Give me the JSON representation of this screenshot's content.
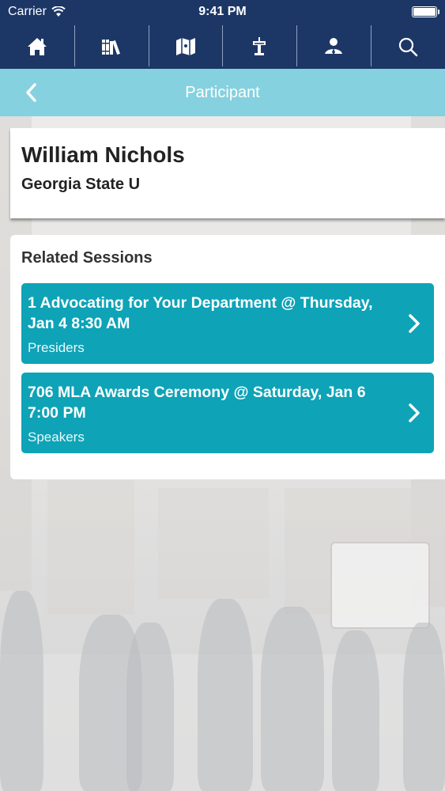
{
  "status_bar": {
    "carrier": "Carrier",
    "time": "9:41 PM",
    "wifi_icon": "wifi-icon",
    "battery_icon": "battery-icon"
  },
  "nav": {
    "items": [
      {
        "icon": "home-icon"
      },
      {
        "icon": "books-icon"
      },
      {
        "icon": "map-icon"
      },
      {
        "icon": "podium-icon"
      },
      {
        "icon": "person-icon"
      },
      {
        "icon": "search-icon"
      }
    ]
  },
  "header": {
    "title": "Participant",
    "back_icon": "chevron-left-icon",
    "color": "#86d1df"
  },
  "participant": {
    "name": "William Nichols",
    "organization": "Georgia State U"
  },
  "related_sessions": {
    "heading": "Related Sessions",
    "items": [
      {
        "title": "1 Advocating for Your Department @ Thursday, Jan 4 8:30 AM",
        "role": "Presiders"
      },
      {
        "title": "706 MLA Awards Ceremony @ Saturday, Jan 6 7:00 PM",
        "role": "Speakers"
      }
    ],
    "card_color": "#0ea3b7"
  },
  "colors": {
    "nav_background": "#1c3766",
    "title_bar": "#86d1df",
    "session_card": "#0ea3b7"
  }
}
